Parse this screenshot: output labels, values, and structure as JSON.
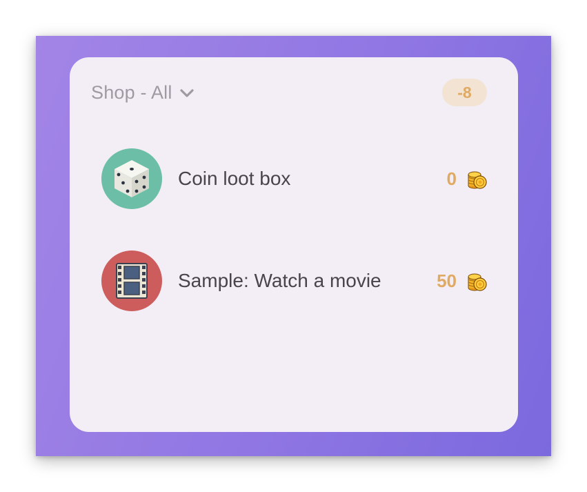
{
  "shop": {
    "title": "Shop - All",
    "balance": "-8"
  },
  "colors": {
    "accent_gold": "#e0aa62",
    "background_purple": "#8f76e3",
    "card_bg": "#f3eef5",
    "dice_icon_bg": "#6cbfa6",
    "movie_icon_bg": "#cd5c5c"
  },
  "items": [
    {
      "label": "Coin loot box",
      "price": "0",
      "icon": "dice-icon"
    },
    {
      "label": "Sample: Watch a movie",
      "price": "50",
      "icon": "film-icon"
    }
  ]
}
